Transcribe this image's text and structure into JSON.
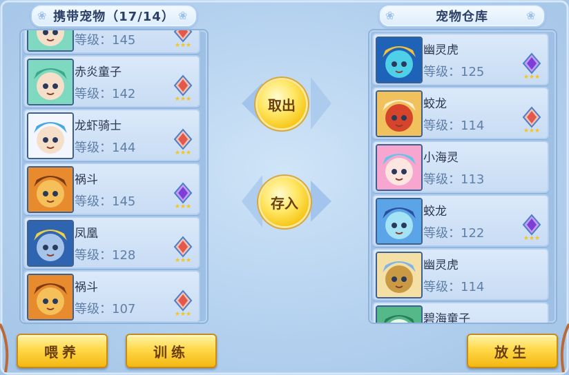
{
  "carry_panel": {
    "title": "携带宠物（17/14）",
    "level_prefix": "等级：",
    "pets": [
      {
        "name": "",
        "level": "145",
        "portrait": "green-hair-child",
        "gem": "fire-gem"
      },
      {
        "name": "赤炎童子",
        "level": "142",
        "portrait": "green-hair-child",
        "gem": "fire-gem"
      },
      {
        "name": "龙虾骑士",
        "level": "144",
        "portrait": "white-hair-knight",
        "gem": "fire-gem"
      },
      {
        "name": "祸斗",
        "level": "145",
        "portrait": "orange-beast",
        "gem": "purple-gem"
      },
      {
        "name": "凤凰",
        "level": "128",
        "portrait": "blue-dragon-armor",
        "gem": "fire-gem"
      },
      {
        "name": "祸斗",
        "level": "107",
        "portrait": "orange-beast",
        "gem": "fire-gem"
      }
    ]
  },
  "storage_panel": {
    "title": "宠物仓库",
    "level_prefix": "等级：",
    "pets": [
      {
        "name": "幽灵虎",
        "level": "125",
        "portrait": "blue-tiger",
        "gem": "purple-gem"
      },
      {
        "name": "蛟龙",
        "level": "114",
        "portrait": "red-dragon",
        "gem": "fire-gem"
      },
      {
        "name": "小海灵",
        "level": "113",
        "portrait": "pink-girl",
        "gem": ""
      },
      {
        "name": "蛟龙",
        "level": "122",
        "portrait": "ice-dragon",
        "gem": "purple-gem"
      },
      {
        "name": "幽灵虎",
        "level": "114",
        "portrait": "golden-tiger",
        "gem": ""
      },
      {
        "name": "碧海童子",
        "level": "",
        "portrait": "green-child",
        "gem": ""
      }
    ]
  },
  "actions": {
    "take_out": "取出",
    "store": "存入",
    "feed": "喂养",
    "train": "训练",
    "release": "放生"
  },
  "colors": {
    "background": "#b4d1ef",
    "panel": "#9fc0e5",
    "card": "#d3e4f8",
    "button_gold": "#ffd94a",
    "button_text": "#6b3e0e",
    "level_text": "#5f7fa7"
  }
}
